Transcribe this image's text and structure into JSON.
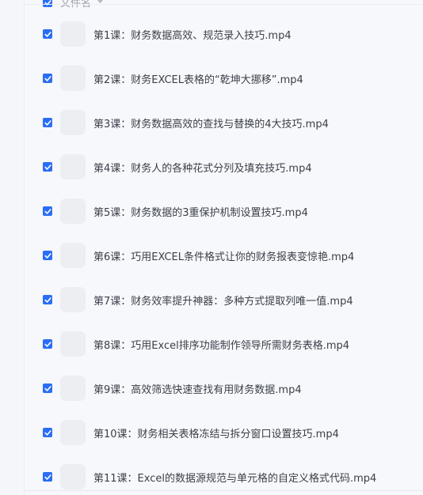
{
  "header": {
    "label": "文件名",
    "checked": true
  },
  "files": [
    {
      "name": "第1课：财务数据高效、规范录入技巧.mp4",
      "checked": true
    },
    {
      "name": "第2课：财务EXCEL表格的“乾坤大挪移”.mp4",
      "checked": true
    },
    {
      "name": "第3课：财务数据高效的查找与替换的4大技巧.mp4",
      "checked": true
    },
    {
      "name": "第4课：财务人的各种花式分列及填充技巧.mp4",
      "checked": true
    },
    {
      "name": "第5课：财务数据的3重保护机制设置技巧.mp4",
      "checked": true
    },
    {
      "name": "第6课：巧用EXCEL条件格式让你的财务报表变惊艳.mp4",
      "checked": true
    },
    {
      "name": "第7课：财务效率提升神器：多种方式提取列唯一值.mp4",
      "checked": true
    },
    {
      "name": "第8课：巧用Excel排序功能制作领导所需财务表格.mp4",
      "checked": true
    },
    {
      "name": "第9课：高效筛选快速查找有用财务数据.mp4",
      "checked": true
    },
    {
      "name": "第10课：财务相关表格冻结与拆分窗口设置技巧.mp4",
      "checked": true
    },
    {
      "name": "第11课：Excel的数据源规范与单元格的自定义格式代码.mp4",
      "checked": true
    }
  ],
  "icons": {
    "checkbox": "checkbox-checked-icon",
    "thumbnail": "video-file-thumbnail-icon",
    "sort": "sort-down-icon"
  },
  "colors": {
    "accent": "#2b6ef5",
    "panel": "#f7f8fc",
    "text": "#3a3f47",
    "thumbnail": "#eceef2"
  }
}
